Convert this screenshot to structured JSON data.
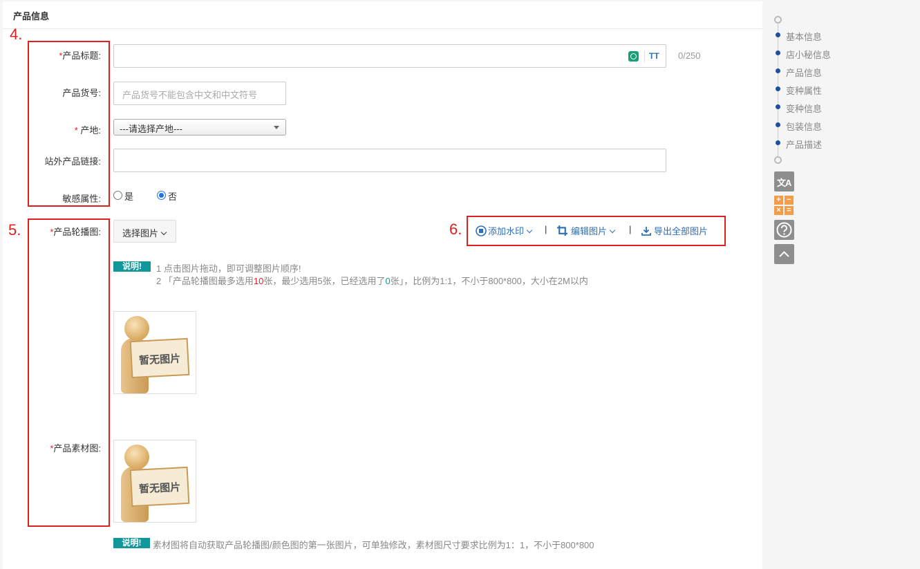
{
  "section": {
    "title": "产品信息"
  },
  "annotations": {
    "n4": "4.",
    "n5": "5.",
    "n6": "6."
  },
  "form": {
    "required_mark": "*",
    "title": {
      "label": "产品标题:",
      "counter": "0/250",
      "value": ""
    },
    "sku": {
      "label": "产品货号:",
      "placeholder": "产品货号不能包含中文和中文符号"
    },
    "origin": {
      "label": "产地:",
      "selected": "---请选择产地---"
    },
    "external_link": {
      "label": "站外产品链接:",
      "value": ""
    },
    "sensitive": {
      "label": "敏感属性:",
      "options": [
        "是",
        "否"
      ],
      "selected": "否"
    },
    "carousel": {
      "label": "产品轮播图:"
    },
    "material": {
      "label": "产品素材图:"
    }
  },
  "toolbar": {
    "select_image": "选择图片",
    "add_watermark": "添加水印",
    "edit_image": "编辑图片",
    "export_all": "导出全部图片",
    "separator": "|",
    "tt_icon_text": "TT"
  },
  "notes": {
    "badge": "说明!",
    "carousel_line1": "1 点击图片拖动，即可调整图片顺序!",
    "carousel_line2_a": "2 「产品轮播图最多选用",
    "carousel_max": "10",
    "carousel_line2_b": "张，最少选用5张，已经选用了",
    "carousel_selected": "0",
    "carousel_line2_c": "张」，比例为1:1，不小于800*800，大小在2M以内",
    "material_note": "素材图将自动获取产品轮播图/颜色图的第一张图片，可单独修改，素材图尺寸要求比例为1：1，不小于800*800"
  },
  "placeholder_image": {
    "text": "暂无图片"
  },
  "sidebar": {
    "nav": [
      "基本信息",
      "店小秘信息",
      "产品信息",
      "变种属性",
      "变种信息",
      "包装信息",
      "产品描述"
    ],
    "translate_icon_text": "文A"
  },
  "colors": {
    "accent_blue": "#2d6fb5",
    "required_red": "#e02020",
    "badge_teal": "#10969b",
    "timeline_navy": "#1f4f9c"
  }
}
